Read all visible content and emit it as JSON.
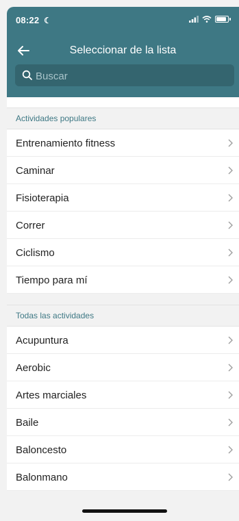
{
  "status_bar": {
    "time": "08:22"
  },
  "nav": {
    "title": "Seleccionar de la lista"
  },
  "search": {
    "placeholder": "Buscar"
  },
  "sections": [
    {
      "header": "Actividades populares",
      "items": [
        "Entrenamiento fitness",
        "Caminar",
        "Fisioterapia",
        "Correr",
        "Ciclismo",
        "Tiempo para mí"
      ]
    },
    {
      "header": "Todas las actividades",
      "items": [
        "Acupuntura",
        "Aerobic",
        "Artes marciales",
        "Baile",
        "Baloncesto",
        "Balonmano"
      ]
    }
  ],
  "colors": {
    "header_bg": "#3e7884",
    "search_bg": "#34656f",
    "section_text": "#3e7884"
  },
  "icons": {
    "back": "arrow-left-icon",
    "search": "search-icon",
    "chevron": "chevron-right-icon"
  }
}
